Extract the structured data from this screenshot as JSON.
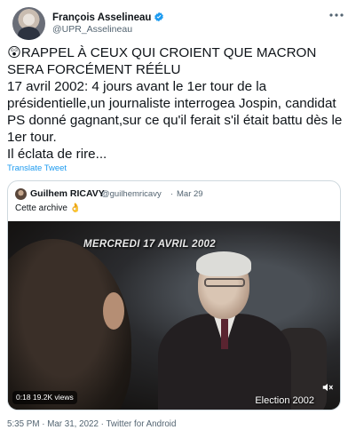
{
  "author": {
    "name": "François Asselineau",
    "handle": "@UPR_Asselineau",
    "verified_color": "#1d9bf0"
  },
  "tweet": {
    "text": "😲RAPPEL À CEUX QUI CROIENT QUE MACRON SERA FORCÉMENT RÉÉLU\n17 avril 2002: 4 jours avant le 1er tour de la présidentielle,un journaliste interrogea Jospin, candidat PS donné gagnant,sur ce qu'il ferait s'il était battu dès le 1er tour.\nIl éclata de rire...",
    "translate_label": "Translate Tweet"
  },
  "quoted_tweet": {
    "author_name": "Guilhem RICAVY",
    "author_handle": "@guilhemricavy",
    "separator": "·",
    "date": "Mar 29",
    "text": "Cette archive 👌",
    "video": {
      "overlay_date": "MERCREDI 17 AVRIL 2002",
      "overlay_caption": "Election 2002",
      "duration_views": "0:18  19.2K views",
      "mute_icon": "speaker-muted-icon"
    }
  },
  "footer": {
    "meta": "5:35 PM · Mar 31, 2022 · Twitter for Android"
  },
  "colors": {
    "text_primary": "#0f1419",
    "text_secondary": "#536471",
    "link": "#1d9bf0",
    "border": "#cfd9de"
  }
}
